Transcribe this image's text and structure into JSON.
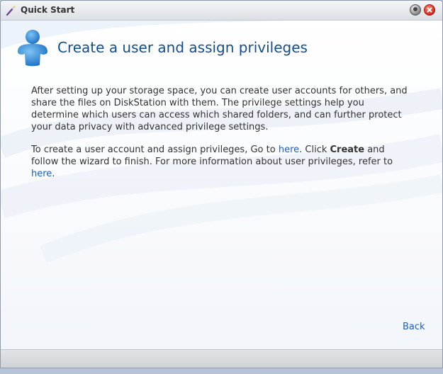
{
  "window": {
    "title": "Quick Start"
  },
  "header": {
    "title": "Create a user and assign privileges"
  },
  "body": {
    "paragraph1": "After setting up your storage space, you can create user accounts for others, and share the files on DiskStation with them. The privilege settings help you determine which users can access which shared folders, and can further protect your data privacy with advanced privilege settings.",
    "p2_part1": "To create a user account and assign privileges, Go to ",
    "p2_link1": "here",
    "p2_part2": ". Click ",
    "p2_bold": "Create",
    "p2_part3": " and follow the wizard to finish. For more information about user privileges, refer to ",
    "p2_link2": "here",
    "p2_part4": "."
  },
  "nav": {
    "back_label": "Back"
  },
  "icons": {
    "title": "wand-icon",
    "help": "help-icon",
    "close": "close-icon",
    "user": "user-icon"
  },
  "colors": {
    "heading": "#134e8a",
    "link": "#1e5fbf",
    "text": "#333333"
  }
}
